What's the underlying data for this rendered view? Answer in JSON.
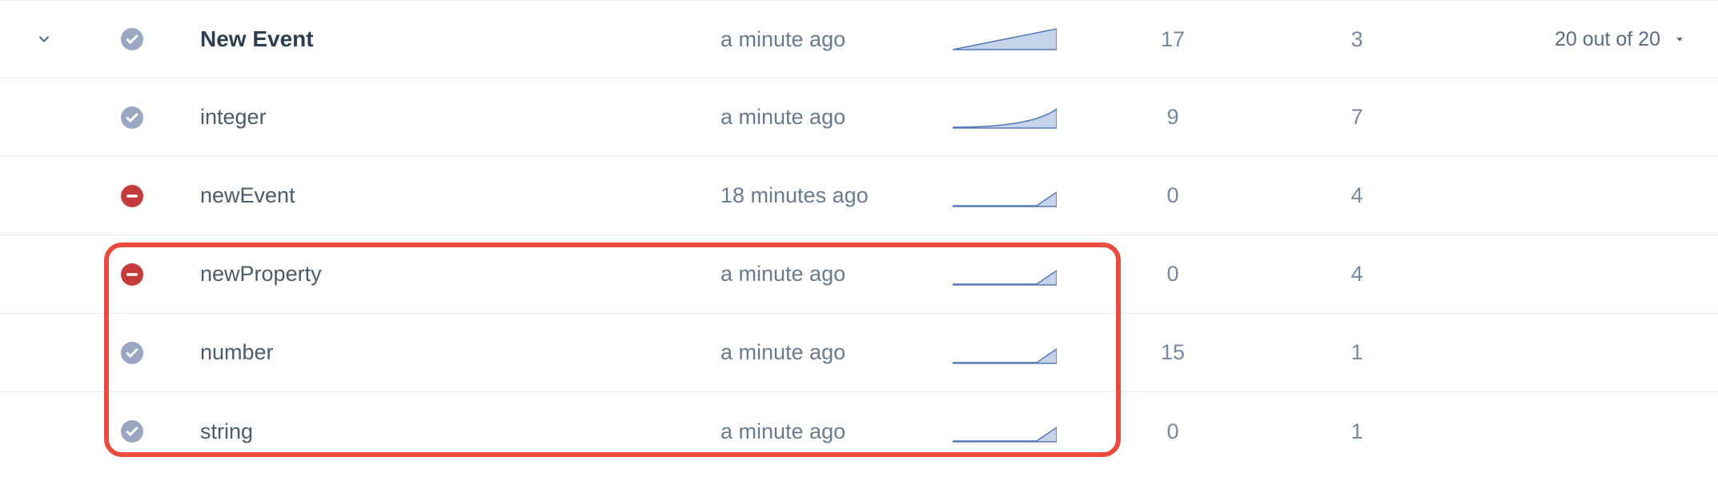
{
  "pager": {
    "label": "20 out of 20"
  },
  "rows": [
    {
      "status": "check",
      "name": "New Event",
      "time": "a minute ago",
      "spark": "tri",
      "v1": "17",
      "v2": "3"
    },
    {
      "status": "check",
      "name": "integer",
      "time": "a minute ago",
      "spark": "curve",
      "v1": "9",
      "v2": "7"
    },
    {
      "status": "minus",
      "name": "newEvent",
      "time": "18 minutes ago",
      "spark": "flat",
      "v1": "0",
      "v2": "4"
    },
    {
      "status": "minus",
      "name": "newProperty",
      "time": "a minute ago",
      "spark": "flat",
      "v1": "0",
      "v2": "4"
    },
    {
      "status": "check",
      "name": "number",
      "time": "a minute ago",
      "spark": "flat",
      "v1": "15",
      "v2": "1"
    },
    {
      "status": "check",
      "name": "string",
      "time": "a minute ago",
      "spark": "flat",
      "v1": "0",
      "v2": "1"
    }
  ]
}
